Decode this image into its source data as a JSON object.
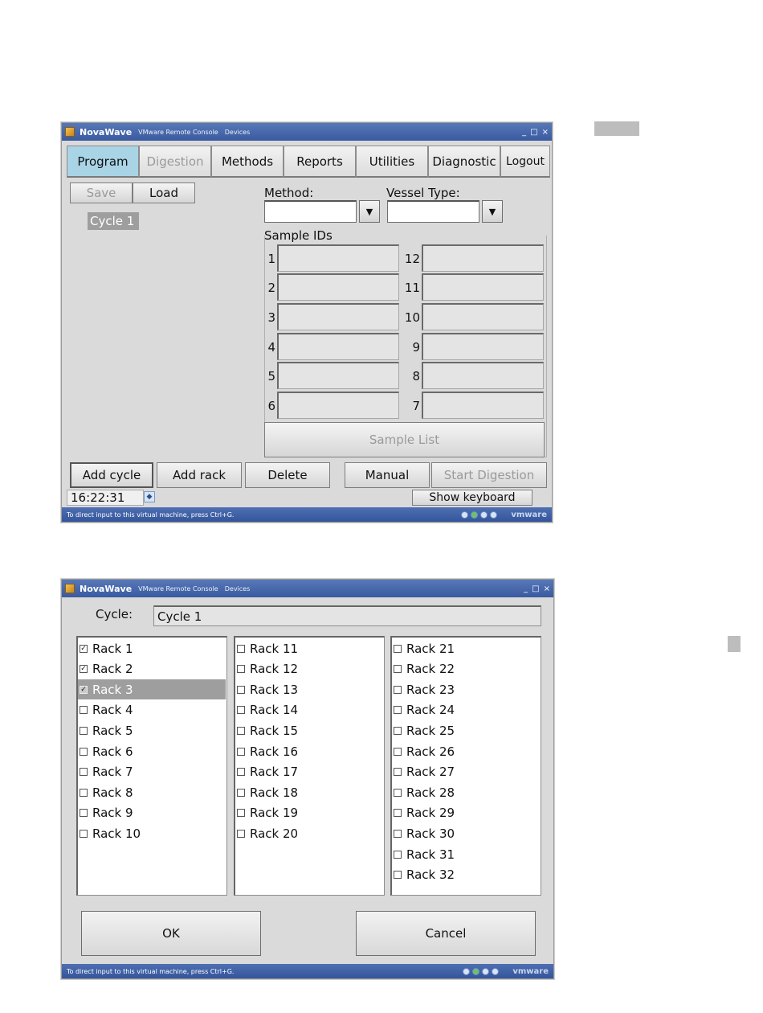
{
  "window_title": {
    "app_name": "NovaWave",
    "menu": [
      "VMware Remote Console",
      "Devices"
    ],
    "controls": [
      "_",
      "□",
      "×"
    ]
  },
  "vm_status": {
    "message": "To direct input to this virtual machine, press Ctrl+G.",
    "brand": "vmware"
  },
  "main": {
    "tabs": [
      {
        "label": "Program",
        "active": true
      },
      {
        "label": "Digestion",
        "disabled": true
      },
      {
        "label": "Methods"
      },
      {
        "label": "Reports"
      },
      {
        "label": "Utilities"
      },
      {
        "label": "Diagnostic"
      },
      {
        "label": "Logout"
      }
    ],
    "save_label": "Save",
    "load_label": "Load",
    "cycle_item": "Cycle 1",
    "method_label": "Method:",
    "method_value": "",
    "vessel_label": "Vessel Type:",
    "vessel_value": "",
    "sample_ids_label": "Sample IDs",
    "sample_left": [
      "1",
      "2",
      "3",
      "4",
      "5",
      "6"
    ],
    "sample_right": [
      "12",
      "11",
      "10",
      "9",
      "8",
      "7"
    ],
    "sample_list_label": "Sample List",
    "bottom_buttons": [
      "Add cycle",
      "Add rack",
      "Delete",
      "Manual",
      "Start Digestion"
    ],
    "time": "16:22:31",
    "show_keyboard_label": "Show keyboard"
  },
  "dialog": {
    "cycle_label": "Cycle:",
    "cycle_value": "Cycle 1",
    "col1": [
      "Rack 1",
      "Rack 2",
      "Rack 3",
      "Rack 4",
      "Rack 5",
      "Rack 6",
      "Rack 7",
      "Rack 8",
      "Rack 9",
      "Rack 10"
    ],
    "col2": [
      "Rack 11",
      "Rack 12",
      "Rack 13",
      "Rack 14",
      "Rack 15",
      "Rack 16",
      "Rack 17",
      "Rack 18",
      "Rack 19",
      "Rack 20"
    ],
    "col3": [
      "Rack 21",
      "Rack 22",
      "Rack 23",
      "Rack 24",
      "Rack 25",
      "Rack 26",
      "Rack 27",
      "Rack 28",
      "Rack 29",
      "Rack 30",
      "Rack 31",
      "Rack 32"
    ],
    "checked": [
      "Rack 1",
      "Rack 2",
      "Rack 3"
    ],
    "selected": "Rack 3",
    "ok_label": "OK",
    "cancel_label": "Cancel"
  }
}
